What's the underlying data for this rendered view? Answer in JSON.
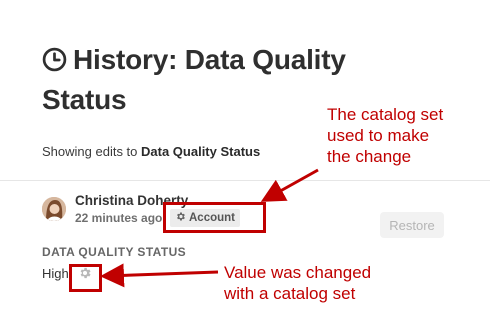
{
  "page": {
    "title": "History: Data Quality Status",
    "title_line1": "History: Data Quality",
    "title_line2": "Status",
    "title_icon": "clock-icon",
    "subtitle_prefix": "Showing edits to ",
    "subtitle_subject": "Data Quality Status"
  },
  "edit": {
    "user_name": "Christina Doherty",
    "time_ago": "22 minutes ago",
    "catalog_set": "Account",
    "catalog_icon": "gear-icon",
    "restore_label": "Restore",
    "field_label": "DATA QUALITY STATUS",
    "field_value": "High"
  },
  "annotations": {
    "catalog_note": "The catalog set used to make the change",
    "catalog_note_lines": [
      "The catalog set",
      "used to make",
      "the change"
    ],
    "value_note": "Value was changed with a catalog set",
    "value_note_lines": [
      "Value was changed",
      "with a catalog set"
    ],
    "color": "#c00000"
  }
}
